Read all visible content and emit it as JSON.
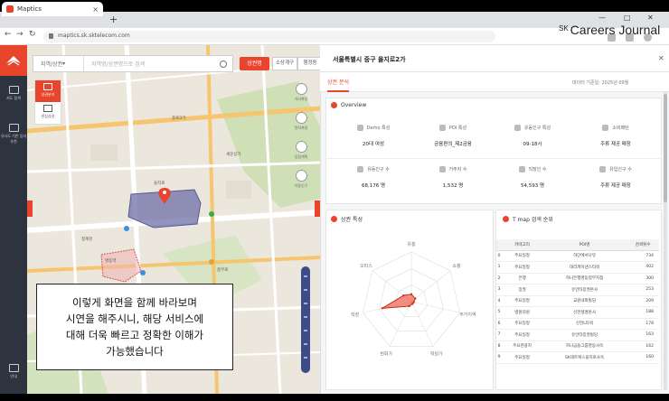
{
  "browser": {
    "tab_title": "Maptics",
    "url": "maptics.sk.sktelecom.com",
    "new_tab": "+",
    "close_tab": "×"
  },
  "watermark": {
    "sk": "SK",
    "name": "Careers Journal"
  },
  "rail": {
    "items": [
      "지도 탐색",
      "유사도 기반 입지추천",
      "안내"
    ]
  },
  "map": {
    "search_select": "지역/상권",
    "search_placeholder": "지역명/상권명으로 검색",
    "analyze_button": "상권명",
    "tabs": [
      "소상계구",
      "행정동"
    ],
    "tools": [
      "상권분석",
      "관심상권"
    ],
    "right_tools": [
      "거리측정",
      "면적측정",
      "입점계획",
      "이동인구"
    ],
    "labels": [
      "을지로",
      "종로3가",
      "명동역",
      "청계천",
      "충무로",
      "세운상가"
    ]
  },
  "overlay_caption": [
    "이렇게 화면을 함께 바라보며",
    "시연을 해주시니, 해당 서비스에",
    "대해 더욱 빠르고 정확한 이해가",
    "가능했습니다"
  ],
  "panel": {
    "title": "서울특별시 중구 을지로2가",
    "tab": "상권 분석",
    "date": "데이터 기준일: 2025년 09월",
    "overview_title": "Overview",
    "metrics_row1": [
      {
        "label": "Demo 특성",
        "value": "20대 여성"
      },
      {
        "label": "POI 특성",
        "value": "금융편의_제2금융"
      },
      {
        "label": "유동인구 특성",
        "value": "09-18시"
      },
      {
        "label": "소비패턴",
        "value": "주류 제공 매장"
      }
    ],
    "metrics_row2": [
      {
        "label": "유동인구 수",
        "value": "68,176 명"
      },
      {
        "label": "거주자 수",
        "value": "1,532 명"
      },
      {
        "label": "직장인 수",
        "value": "54,593 명"
      },
      {
        "label": "유입인구 수",
        "value": "주류 제공 매장"
      }
    ],
    "feature_title": "상권 특성",
    "tmap_title": "T map 검색 순위",
    "radar_labels": [
      "유흥",
      "쇼핑",
      "주거지역",
      "학원가",
      "번화가",
      "직장",
      "오피스"
    ],
    "table_headers": [
      "",
      "카테고리",
      "POI명",
      "검색횟수"
    ],
    "table_rows": [
      [
        "0",
        "주요일정",
        "하단에서나뮤",
        "734"
      ],
      [
        "1",
        "주요일정",
        "대리파이낸스타워",
        "402"
      ],
      [
        "2",
        "은행",
        "하나은행명동업무지점",
        "300"
      ],
      [
        "3",
        "증권",
        "유안타증권본사",
        "253"
      ],
      [
        "4",
        "주요일정",
        "교원내외빌딩",
        "209"
      ],
      [
        "5",
        "병원의원",
        "신한생명본사",
        "188"
      ],
      [
        "6",
        "주요일정",
        "신한L타워",
        "178"
      ],
      [
        "7",
        "주요일정",
        "유안타증권빌딩",
        "163"
      ],
      [
        "8",
        "주요관광지",
        "하나금융그룹명동사옥",
        "162"
      ],
      [
        "9",
        "주요일정",
        "SK네트웍스을지로사옥",
        "160"
      ]
    ]
  },
  "colors": {
    "accent": "#e8452c",
    "rail": "#2e3340",
    "zoom": "#3b4c88"
  },
  "chart_data": {
    "type": "radar",
    "categories": [
      "유흥",
      "쇼핑",
      "주거지역",
      "학원가",
      "번화가",
      "직장",
      "오피스"
    ],
    "values": [
      0.15,
      0.1,
      0.05,
      0.05,
      0.1,
      0.6,
      0.2
    ],
    "range": [
      0,
      1
    ]
  }
}
